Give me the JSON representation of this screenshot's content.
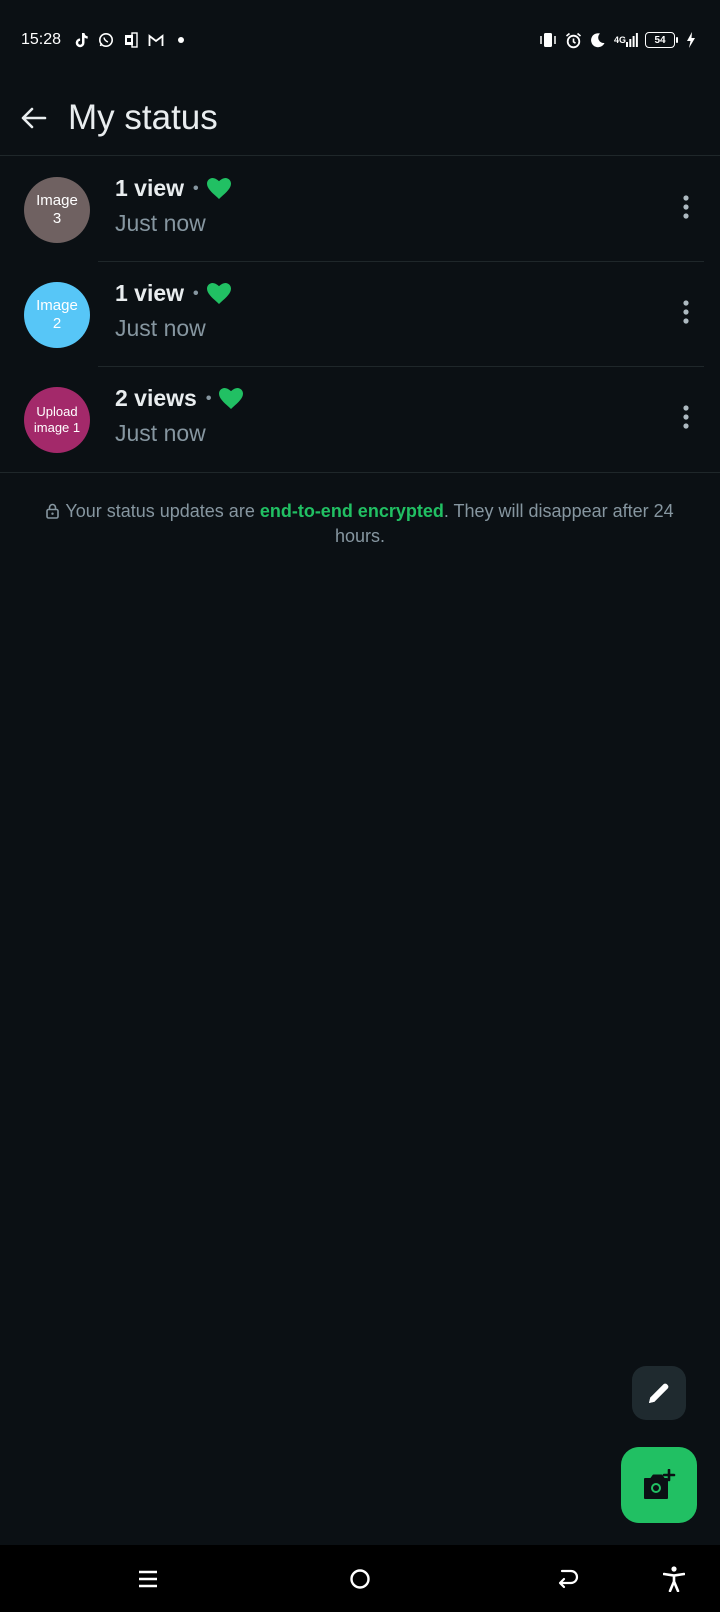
{
  "status_bar": {
    "time": "15:28",
    "battery": "54",
    "network": "4G",
    "left_icons": [
      "tiktok-icon",
      "whatsapp-icon",
      "office-icon",
      "gmail-icon",
      "notification-dot-icon"
    ],
    "right_icons": [
      "vibrate-icon",
      "alarm-icon",
      "do-not-disturb-moon-icon",
      "signal-icon",
      "battery-icon",
      "charging-icon"
    ]
  },
  "header": {
    "title": "My status",
    "back_icon": "arrow-left-icon"
  },
  "statuses": [
    {
      "avatar_text": "Image 3",
      "avatar_color": "#6f6161",
      "views": "1 view",
      "separator": "•",
      "time": "Just now"
    },
    {
      "avatar_text": "Image 2",
      "avatar_color": "#57c6f7",
      "views": "1 view",
      "separator": "•",
      "time": "Just now"
    },
    {
      "avatar_text": "Upload image 1",
      "avatar_color": "#a3296a",
      "views": "2 views",
      "separator": "•",
      "time": "Just now"
    }
  ],
  "encryption_note": {
    "prefix": "Your status updates are ",
    "link": "end-to-end encrypted",
    "suffix": ". They will disappear after 24 hours."
  },
  "colors": {
    "background": "#0b1014",
    "accent": "#21c063",
    "secondary_text": "#8696a0"
  },
  "fabs": {
    "edit_icon": "pencil-icon",
    "camera_icon": "camera-add-icon"
  },
  "nav": [
    "menu-icon",
    "home-circle-icon",
    "back-icon",
    "accessibility-icon"
  ]
}
